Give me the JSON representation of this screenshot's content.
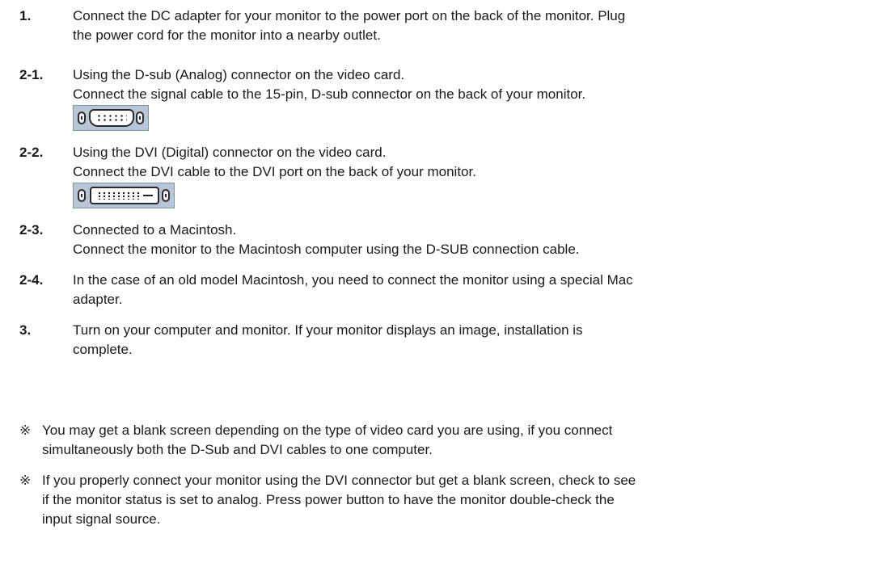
{
  "steps": [
    {
      "num": "1.",
      "lines": [
        "Connect the DC adapter for your monitor to the power port on the back of the monitor. Plug",
        "the power cord for the monitor into a nearby outlet."
      ]
    },
    {
      "num": "2-1.",
      "lines": [
        "Using the D-sub (Analog) connector on the video card.",
        "Connect the signal cable to the 15-pin, D-sub connector on the back of your monitor."
      ],
      "image": "d-sub-connector-icon"
    },
    {
      "num": "2-2.",
      "lines": [
        "Using the DVI (Digital) connector on the video card.",
        "Connect the DVI cable to the DVI port on the back of your monitor."
      ],
      "image": "dvi-connector-icon"
    },
    {
      "num": "2-3.",
      "lines": [
        "Connected to a Macintosh.",
        "Connect the monitor to the Macintosh computer using the D-SUB connection cable."
      ]
    },
    {
      "num": "2-4.",
      "lines": [
        "In the case of an old model Macintosh, you need to connect the monitor using a special Mac",
        "adapter."
      ]
    },
    {
      "num": "3.",
      "lines": [
        "Turn on your computer and monitor. If your monitor displays an image, installation is",
        "complete."
      ]
    }
  ],
  "notes": [
    {
      "mark": "※",
      "lines": [
        "You may get a blank screen depending on the type of video card you are using, if you connect",
        "simultaneously both the D-Sub and DVI cables to one computer."
      ]
    },
    {
      "mark": "※",
      "lines": [
        "If you properly connect your monitor using the DVI connector but get a blank screen, check to see",
        "if the monitor status is set to analog. Press power button to have the monitor double-check the",
        "input signal source."
      ]
    }
  ],
  "colors": {
    "connector_bg": "#b7c6d6",
    "text": "#1a1a1a"
  }
}
